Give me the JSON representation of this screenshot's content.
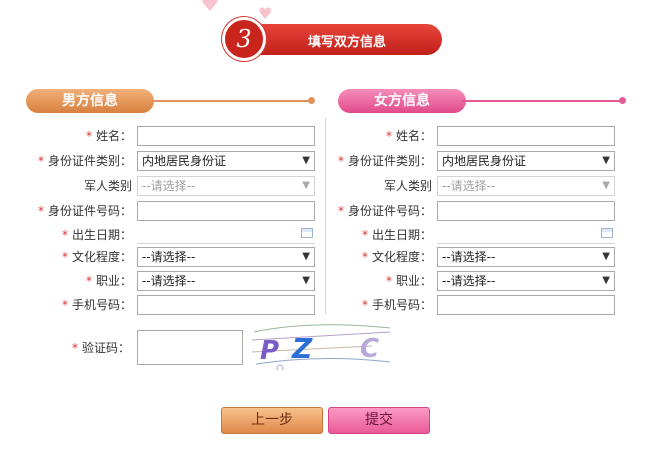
{
  "step": {
    "number": "3",
    "title": "填写双方信息"
  },
  "male": {
    "title": "男方信息",
    "name_label": "姓名：",
    "id_type_label": "身份证件类别：",
    "id_type_value": "内地居民身份证",
    "military_label": "军人类别",
    "military_value": "--请选择--",
    "id_number_label": "身份证件号码：",
    "birth_label": "出生日期：",
    "education_label": "文化程度：",
    "education_value": "--请选择--",
    "job_label": "职业：",
    "job_value": "--请选择--",
    "phone_label": "手机号码："
  },
  "female": {
    "title": "女方信息",
    "name_label": "姓名：",
    "id_type_label": "身份证件类别：",
    "id_type_value": "内地居民身份证",
    "military_label": "军人类别",
    "military_value": "--请选择--",
    "id_number_label": "身份证件号码：",
    "birth_label": "出生日期：",
    "education_label": "文化程度：",
    "education_value": "--请选择--",
    "job_label": "职业：",
    "job_value": "--请选择--",
    "phone_label": "手机号码："
  },
  "captcha": {
    "label": "验证码：",
    "chars": [
      "P",
      "Z",
      "C"
    ]
  },
  "buttons": {
    "prev": "上一步",
    "submit": "提交"
  },
  "required_mark": "*",
  "icons": {
    "select_caret": "chevron-down-icon",
    "calendar": "calendar-icon"
  },
  "colors": {
    "step_red": "#c9251c",
    "male_accent": "#e2925a",
    "female_accent": "#e65a96",
    "required": "#e03030"
  }
}
